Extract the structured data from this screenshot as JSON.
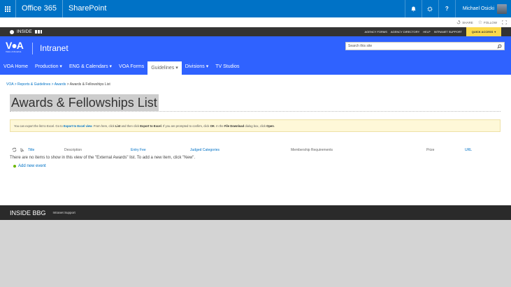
{
  "suite": {
    "brand": "Office 365",
    "site": "SharePoint",
    "user": "Michael Osicki"
  },
  "actions": {
    "share": "SHARE",
    "follow": "FOLLOW"
  },
  "inside_bar": {
    "title": "INSIDE",
    "links": [
      "AGENCY FORMS",
      "AGENCY DIRECTORY",
      "HELP",
      "INTRANET SUPPORT"
    ],
    "quick_access": "QUICK ACCESS"
  },
  "header": {
    "logo": "V●A",
    "logo_sub": "Voice of America",
    "title": "Intranet",
    "search_placeholder": "Search this site"
  },
  "nav": [
    {
      "label": "VOA Home"
    },
    {
      "label": "Production ▾"
    },
    {
      "label": "ENG & Calendars ▾"
    },
    {
      "label": "VOA Forms"
    },
    {
      "label": "Guidelines ▾"
    },
    {
      "label": "Divisions ▾"
    },
    {
      "label": "TV Studios"
    }
  ],
  "breadcrumb": {
    "part1": "VOA",
    "part2": "Reports & Guidelines",
    "part3": "Awards",
    "current": "Awards & Fellowships List"
  },
  "page": {
    "title": "Awards & Fellowships List",
    "notice": {
      "t1": "You can export the list to Excel. Go to ",
      "link1": "Export to Excel view",
      "t2": ". From here, click ",
      "b1": "List",
      "t3": " and then click ",
      "b2": "Export to Excel",
      "t4": ". If you are prompted to confirm, click ",
      "b3": "OK",
      "t5": ". In the ",
      "b4": "File Download",
      "t6": " dialog box, click ",
      "b5": "Open",
      "t7": "."
    }
  },
  "list": {
    "columns": {
      "title": "Title",
      "description": "Description",
      "entry_fee": "Entry Fee",
      "judged": "Judged Categories",
      "membership": "Membership Requirements",
      "prize": "Prize",
      "url": "URL"
    },
    "empty_message": "There are no items to show in this view of the \"External Awards\" list. To add a new item, click \"New\".",
    "add_new": "Add new event"
  },
  "footer": {
    "title": "INSIDE BBG",
    "link": "Intranet Support"
  },
  "colors": {
    "suite_blue": "#0072c6",
    "brand_blue": "#2f62ff",
    "quick_access": "#fbd94c",
    "footer": "#2a2a2a"
  }
}
